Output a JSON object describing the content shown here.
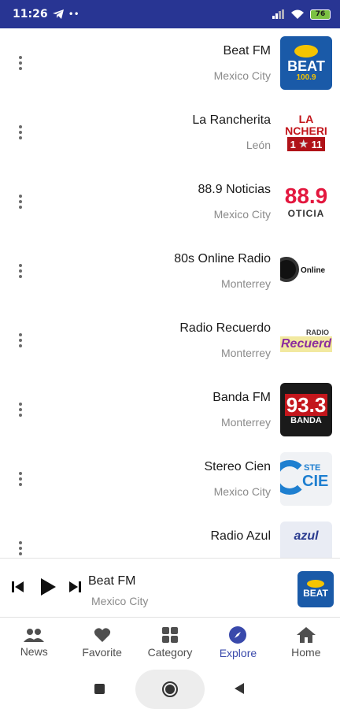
{
  "status_bar": {
    "time": "11:26",
    "battery": "76"
  },
  "stations": [
    {
      "name": "Beat FM",
      "city": "Mexico City"
    },
    {
      "name": "La Rancherita",
      "city": "León"
    },
    {
      "name": "88.9 Noticias",
      "city": "Mexico City"
    },
    {
      "name": "80s Online Radio",
      "city": "Monterrey"
    },
    {
      "name": "Radio Recuerdo",
      "city": "Monterrey"
    },
    {
      "name": "Banda FM",
      "city": "Monterrey"
    },
    {
      "name": "Stereo Cien",
      "city": "Mexico City"
    },
    {
      "name": "Radio Azul",
      "city": ""
    }
  ],
  "logos": {
    "beat": {
      "line1": "BEAT",
      "line2": "100.9"
    },
    "rancherita": {
      "line1": "LA",
      "line2": "NCHERI",
      "line3": "1",
      "line4": "11"
    },
    "noticias": {
      "line1": "88.9",
      "line2": "OTICIA"
    },
    "online": {
      "line1": "Online"
    },
    "recuerdo": {
      "line1": "Recuerd",
      "line2": "RADIO"
    },
    "banda": {
      "line1": "93.3",
      "line2": "BANDA"
    },
    "cien": {
      "line1": "STE",
      "line2": "CIE"
    },
    "azul": {
      "line1": "azul"
    }
  },
  "player": {
    "title": "Beat FM",
    "city": "Mexico City"
  },
  "nav": [
    {
      "label": "News",
      "icon": "people-icon"
    },
    {
      "label": "Favorite",
      "icon": "heart-icon"
    },
    {
      "label": "Category",
      "icon": "grid-icon"
    },
    {
      "label": "Explore",
      "icon": "compass-icon",
      "active": true
    },
    {
      "label": "Home",
      "icon": "home-icon"
    }
  ],
  "colors": {
    "primary": "#283593",
    "accent": "#3949ab"
  }
}
